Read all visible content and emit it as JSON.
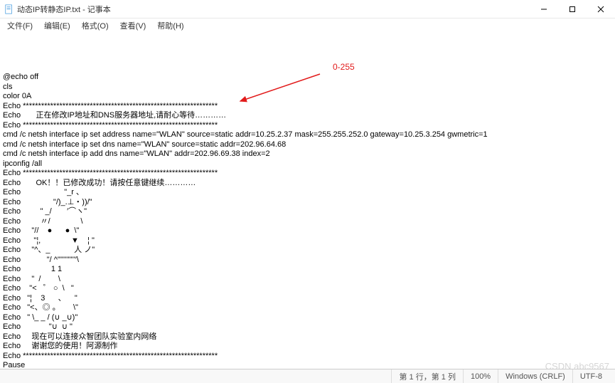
{
  "titlebar": {
    "title": "动态IP转静态IP.txt - 记事本"
  },
  "menubar": {
    "file": "文件(F)",
    "edit": "编辑(E)",
    "format": "格式(O)",
    "view": "查看(V)",
    "help": "帮助(H)"
  },
  "annotation": {
    "label": "0-255"
  },
  "content": {
    "lines": [
      "@echo off",
      "cls",
      "color 0A",
      "Echo ****************************************************************",
      "Echo       正在修改IP地址和DNS服务器地址,请耐心等待…………",
      "Echo ****************************************************************",
      "cmd /c netsh interface ip set address name=\"WLAN\" source=static addr=10.25.2.37 mask=255.255.252.0 gateway=10.25.3.254 gwmetric=1",
      "cmd /c netsh interface ip set dns name=\"WLAN\" source=static addr=202.96.64.68",
      "cmd /c netsh interface ip add dns name=\"WLAN\" addr=202.96.69.38 index=2",
      "ipconfig /all",
      "Echo ****************************************************************",
      "Echo       OK！！已修改成功！请按任意键继续…………",
      "Echo                    \"_r 、",
      "Echo               \"/)_.⊥・))/\"",
      "Echo         \" _/       ′⌒ヽ\"",
      "Echo         〃/              \\",
      "Echo     \"//    ●      ●  \\\"",
      "Echo      \"¦,              ▼    ¦ \"",
      "Echo     \"^、_           人 ノ\"",
      "Echo            \"/ ^\"''''''''''′\\",
      "Echo              1 1",
      "Echo     \"  /        \\",
      "Echo    \"<   ゜ ○  \\   \"",
      "Echo   \"¦    3      、    \"",
      "Echo   \"<、◎ 。      \\\"",
      "Echo   \" \\_ _ / (∪ _∪)\"",
      "Echo             \"∪  ∪ \"",
      "Echo     现在可以连接众智团队实验室内网络",
      "Echo     谢谢您的使用！阿源制作",
      "Echo ****************************************************************",
      "Pause"
    ]
  },
  "statusbar": {
    "position": "第 1 行，第 1 列",
    "zoom": "100%",
    "lineending": "Windows (CRLF)",
    "encoding": "UTF-8"
  },
  "watermark": "CSDN abc9567"
}
